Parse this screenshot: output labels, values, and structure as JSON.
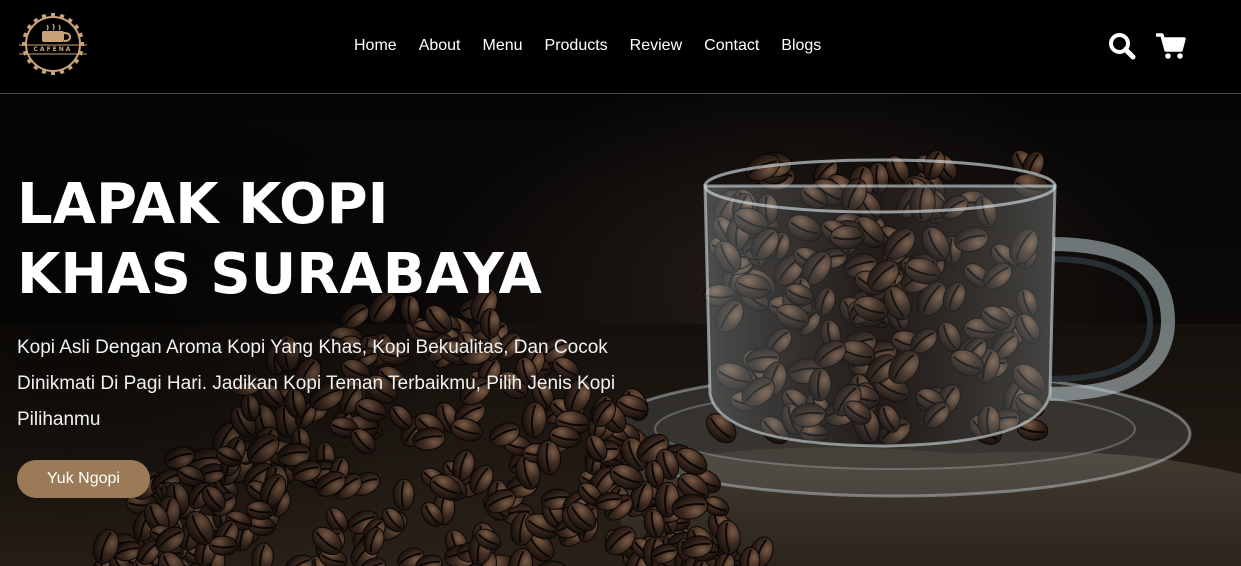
{
  "logo": {
    "icon": "coffee-cup-gear-icon",
    "text": "CAFENA",
    "color": "#c9a27a"
  },
  "nav": {
    "items": [
      {
        "label": "Home"
      },
      {
        "label": "About"
      },
      {
        "label": "Menu"
      },
      {
        "label": "Products"
      },
      {
        "label": "Review"
      },
      {
        "label": "Contact"
      },
      {
        "label": "Blogs"
      }
    ]
  },
  "header_icons": {
    "search": "search-icon",
    "cart": "cart-icon"
  },
  "hero": {
    "title": "LAPAK KOPI KHAS SURABAYA",
    "description": "Kopi Asli Dengan Aroma Kopi Yang Khas, Kopi Bekualitas, Dan Cocok Dinikmati Di Pagi Hari. Jadikan Kopi Teman Terbaikmu, Pilih Jenis Kopi Pilihanmu",
    "cta_label": "Yuk Ngopi",
    "background_image": "glass-cup-of-coffee-beans"
  },
  "colors": {
    "accent": "#9b7b57",
    "header_bg": "#000000",
    "text": "#ffffff"
  }
}
